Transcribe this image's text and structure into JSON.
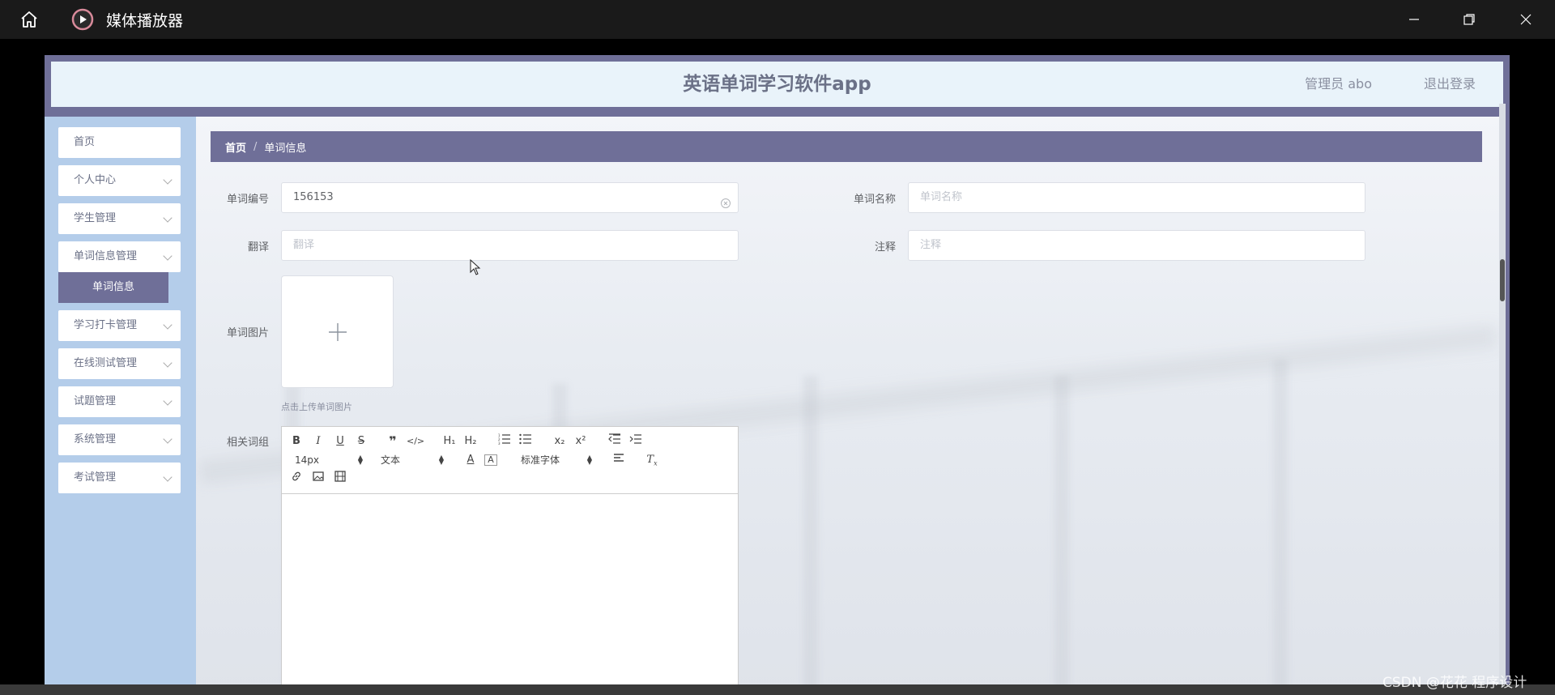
{
  "player": {
    "title": "媒体播放器"
  },
  "app": {
    "title": "英语单词学习软件app",
    "admin": "管理员 abo",
    "logout": "退出登录"
  },
  "sidebar": {
    "items": [
      {
        "label": "首页"
      },
      {
        "label": "个人中心"
      },
      {
        "label": "学生管理"
      },
      {
        "label": "单词信息管理"
      },
      {
        "label": "学习打卡管理"
      },
      {
        "label": "在线测试管理"
      },
      {
        "label": "试题管理"
      },
      {
        "label": "系统管理"
      },
      {
        "label": "考试管理"
      }
    ],
    "submenu": {
      "label": "单词信息"
    }
  },
  "breadcrumb": {
    "home": "首页",
    "separator": "/",
    "current": "单词信息"
  },
  "form": {
    "word_id": {
      "label": "单词编号",
      "value": "156153"
    },
    "word_name": {
      "label": "单词名称",
      "placeholder": "单词名称"
    },
    "translation": {
      "label": "翻译",
      "placeholder": "翻译"
    },
    "note": {
      "label": "注释",
      "placeholder": "注释"
    },
    "image": {
      "label": "单词图片",
      "hint": "点击上传单词图片"
    },
    "phrases": {
      "label": "相关词组"
    }
  },
  "editor": {
    "font_size": "14px",
    "paragraph": "文本",
    "font_family": "标准字体"
  },
  "watermark": "CSDN @花花 程序设计",
  "colors": {
    "accent": "#6f6f98",
    "sidebar": "#b4cdea",
    "header": "#e9f3fa"
  }
}
